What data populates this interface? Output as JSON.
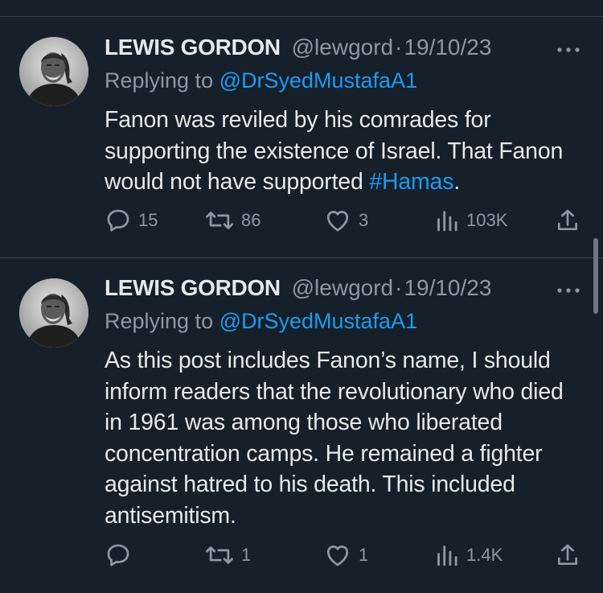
{
  "tweets": [
    {
      "author_name": "LEWIS GORDON",
      "handle": "@lewgord",
      "separator": "·",
      "date": "19/10/23",
      "replying_prefix": "Replying to ",
      "replying_to": "@DrSyedMustafaA1",
      "text_before_tag": "Fanon was reviled by his comrades for supporting the existence of Israel. That Fanon would not have supported ",
      "hashtag": "#Hamas",
      "text_after_tag": ".",
      "replies": "15",
      "retweets": "86",
      "likes": "3",
      "views": "103K"
    },
    {
      "author_name": "LEWIS GORDON",
      "handle": "@lewgord",
      "separator": "·",
      "date": "19/10/23",
      "replying_prefix": "Replying to ",
      "replying_to": "@DrSyedMustafaA1",
      "text": "As this post includes Fanon’s name, I should inform readers that the revolutionary who died in 1961 was among those who liberated concentration camps. He remained a fighter against hatred to his death. This included antisemitism.",
      "replies": "",
      "retweets": "1",
      "likes": "1",
      "views": "1.4K"
    }
  ],
  "icons": {
    "reply": "reply-icon",
    "retweet": "retweet-icon",
    "like": "heart-icon",
    "views": "views-chart-icon",
    "share": "share-icon",
    "more": "more-dots-icon"
  },
  "colors": {
    "background": "#15202b",
    "text": "#e7e9ea",
    "secondary": "#8b98a5",
    "link": "#1d9bf0",
    "divider": "#38444d"
  }
}
